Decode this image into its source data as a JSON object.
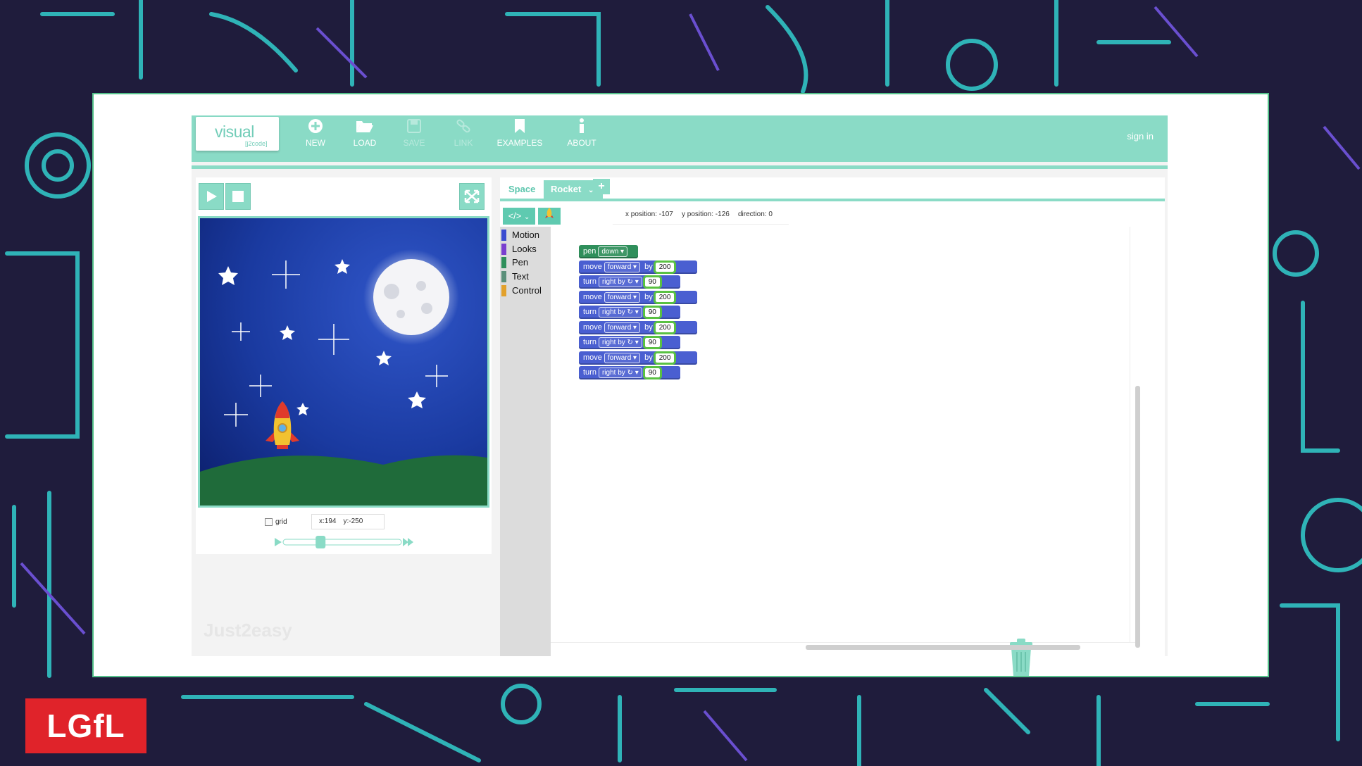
{
  "toolbar": {
    "logo_main": "visual",
    "logo_sub": "[j2code]",
    "buttons": [
      {
        "label": "NEW",
        "icon": "plus-circle-icon",
        "enabled": true
      },
      {
        "label": "LOAD",
        "icon": "folder-open-icon",
        "enabled": true
      },
      {
        "label": "SAVE",
        "icon": "save-icon",
        "enabled": false
      },
      {
        "label": "LINK",
        "icon": "link-icon",
        "enabled": false
      },
      {
        "label": "EXAMPLES",
        "icon": "bookmark-icon",
        "enabled": true
      },
      {
        "label": "ABOUT",
        "icon": "info-icon",
        "enabled": true
      }
    ],
    "sign_in": "sign in"
  },
  "stage": {
    "grid_label": "grid",
    "mouse_x": "x:194",
    "mouse_y": "y:-250",
    "speed": 0.3,
    "watermark": "Just2easy"
  },
  "tabs": {
    "items": [
      {
        "label": "Space",
        "active": false
      },
      {
        "label": "Rocket",
        "active": true
      }
    ],
    "add": "+"
  },
  "sprite_info": {
    "x_position": "x position: -107",
    "y_position": "y position: -126",
    "direction": "direction: 0"
  },
  "palette": [
    {
      "label": "Motion",
      "color": "#3a4bd0"
    },
    {
      "label": "Looks",
      "color": "#7a3fcf"
    },
    {
      "label": "Pen",
      "color": "#2f8f5b"
    },
    {
      "label": "Text",
      "color": "#5b8f7a"
    },
    {
      "label": "Control",
      "color": "#e2a12c"
    }
  ],
  "blocks": [
    {
      "type": "pen",
      "word": "pen",
      "option": "down",
      "value": ""
    },
    {
      "type": "move",
      "word": "move",
      "option": "forward",
      "by": "by",
      "value": "200"
    },
    {
      "type": "turn",
      "word": "turn",
      "option": "right by ↻",
      "value": "90"
    },
    {
      "type": "move",
      "word": "move",
      "option": "forward",
      "by": "by",
      "value": "200"
    },
    {
      "type": "turn",
      "word": "turn",
      "option": "right by ↻",
      "value": "90"
    },
    {
      "type": "move",
      "word": "move",
      "option": "forward",
      "by": "by",
      "value": "200"
    },
    {
      "type": "turn",
      "word": "turn",
      "option": "right by ↻",
      "value": "90"
    },
    {
      "type": "move",
      "word": "move",
      "option": "forward",
      "by": "by",
      "value": "200"
    },
    {
      "type": "turn",
      "word": "turn",
      "option": "right by ↻",
      "value": "90"
    }
  ],
  "brand": "LGfL",
  "colors": {
    "accent": "#8adbc6",
    "motion": "#4a5fd1",
    "pen": "#2f8f5b",
    "number_outline": "#59c142"
  }
}
